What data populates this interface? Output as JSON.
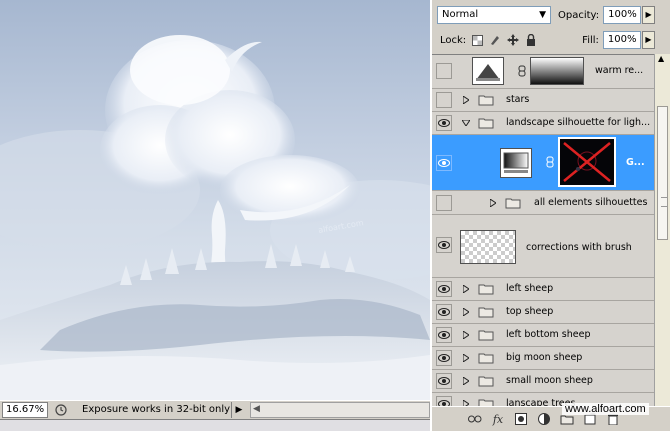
{
  "canvas": {
    "watermark_text": "alfoart.com"
  },
  "statusbar": {
    "zoom": "16.67%",
    "status_text": "Exposure works in 32-bit only",
    "arrow": "▶",
    "scroll_left": "◀"
  },
  "panel": {
    "blend_mode": "Normal",
    "opacity_label": "Opacity:",
    "opacity_value": "100%",
    "lock_label": "Lock:",
    "fill_label": "Fill:",
    "fill_value": "100%"
  },
  "layers": [
    {
      "name": "warm re...",
      "visible": false,
      "kind": "adjustment"
    },
    {
      "name": "stars",
      "visible": false,
      "kind": "group",
      "expanded": false
    },
    {
      "name": "landscape silhouette for ligh...",
      "visible": true,
      "kind": "group",
      "expanded": true
    },
    {
      "name": "G...",
      "visible": true,
      "kind": "adjustment-mask",
      "selected": true
    },
    {
      "name": "all elements silhouettes",
      "visible": false,
      "kind": "group",
      "expanded": false,
      "indent": true
    },
    {
      "name": "corrections with brush",
      "visible": true,
      "kind": "pixel"
    },
    {
      "name": "left sheep",
      "visible": true,
      "kind": "group",
      "expanded": false
    },
    {
      "name": "top sheep",
      "visible": true,
      "kind": "group",
      "expanded": false
    },
    {
      "name": "left bottom sheep",
      "visible": true,
      "kind": "group",
      "expanded": false
    },
    {
      "name": "big moon sheep",
      "visible": true,
      "kind": "group",
      "expanded": false
    },
    {
      "name": "small moon sheep",
      "visible": true,
      "kind": "group",
      "expanded": false
    },
    {
      "name": "lanscape trees",
      "visible": true,
      "kind": "group",
      "expanded": false
    }
  ],
  "footer_watermark": "www.alfoart.com",
  "colors": {
    "selection": "#3b9cff",
    "panel_bg": "#d4d0c8"
  }
}
